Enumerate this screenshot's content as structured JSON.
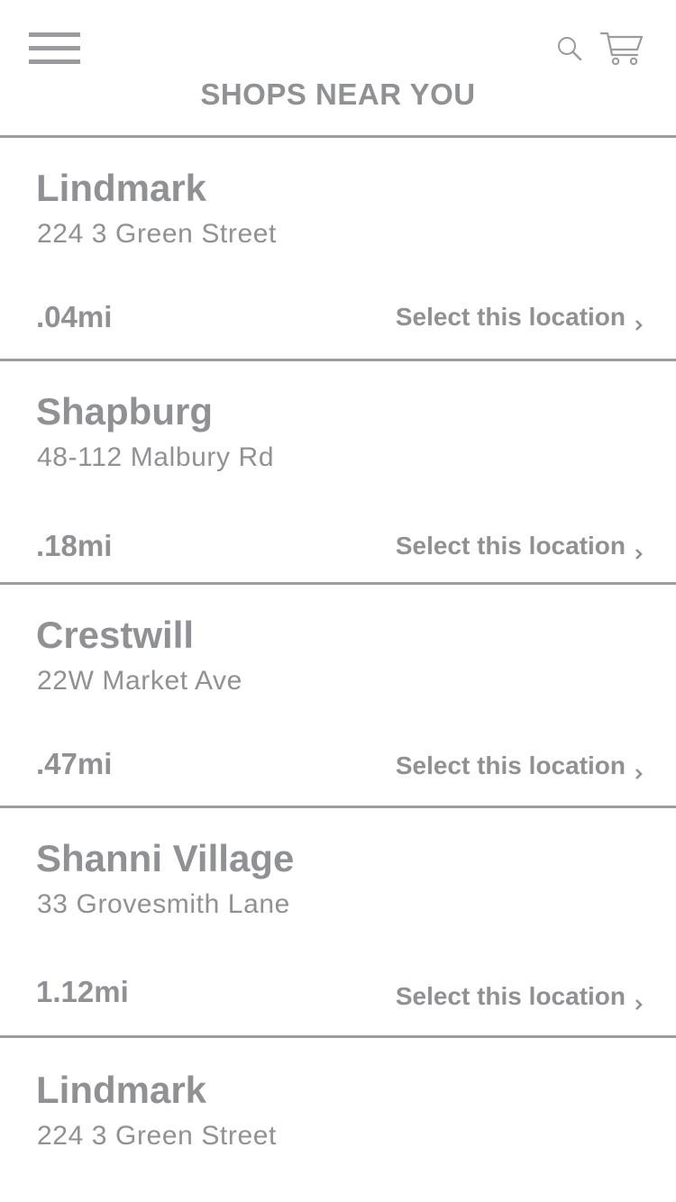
{
  "header": {
    "title": "SHOPS NEAR YOU",
    "menu_icon": "hamburger-menu-icon",
    "search_icon": "search-icon",
    "cart_icon": "shopping-cart-icon"
  },
  "shops": [
    {
      "name": "Lindmark",
      "address": "224 3 Green Street",
      "distance": ".04mi",
      "action": "Select this location"
    },
    {
      "name": "Shapburg",
      "address": "48-112 Malbury Rd",
      "distance": ".18mi",
      "action": "Select this location"
    },
    {
      "name": "Crestwill",
      "address": "22W Market Ave",
      "distance": ".47mi",
      "action": "Select this location"
    },
    {
      "name": "Shanni Village",
      "address": "33 Grovesmith Lane",
      "distance": "1.12mi",
      "action": "Select this location"
    },
    {
      "name": "Lindmark",
      "address": "224 3 Green Street"
    }
  ],
  "colors": {
    "text": "#8f9194",
    "divider": "#9a9c9f",
    "background": "#ffffff"
  }
}
